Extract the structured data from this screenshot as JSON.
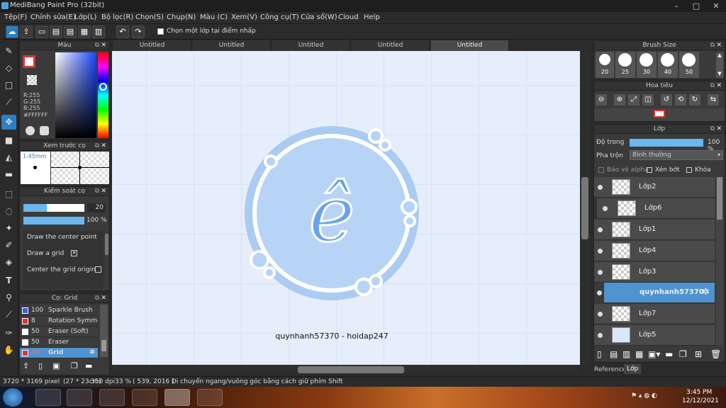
{
  "app": {
    "title": "MediBang Paint Pro (32bit)"
  },
  "menu": [
    "Tệp(F)",
    "Chỉnh sửa(E)",
    "Lớp(L)",
    "Bộ lọc(R)",
    "Chọn(S)",
    "Chụp(N)",
    "Màu (C)",
    "Xem(V)",
    "Công cụ(T)",
    "Cửa sổ(W)",
    "Cloud",
    "Help"
  ],
  "toolbar": {
    "select_one_layer_label": "Chọn một lớp tại điểm nhấp"
  },
  "tabs": [
    "Untitled",
    "Untitled",
    "Untitled",
    "Untitled",
    "Untitled"
  ],
  "color_panel": {
    "title": "Màu",
    "r": "R:255",
    "g": "G:255",
    "b": "B:255",
    "hex": "#FFFFFF"
  },
  "brush_preview": {
    "title": "Xem trước cọ",
    "size": "1.45mm"
  },
  "brush_control": {
    "title": "Kiểm soát cọ",
    "size_value": "20",
    "opacity_value": "100 %",
    "options": [
      "Draw the center point",
      "Draw a grid",
      "Center the grid origin"
    ]
  },
  "brush_list": {
    "title": "Cọ: Grid",
    "items": [
      {
        "size": "100",
        "name": "Sparkle Brush",
        "color": "#3b5bdb"
      },
      {
        "size": "8",
        "name": "Rotation Symmetry",
        "color": "#e03131"
      },
      {
        "size": "50",
        "name": "Eraser (Soft)",
        "color": "#ffffff"
      },
      {
        "size": "50",
        "name": "Eraser",
        "color": "#ffffff"
      },
      {
        "size": "20",
        "name": "Grid",
        "color": "#e03131"
      }
    ]
  },
  "brush_size": {
    "title": "Brush Size",
    "sizes": [
      "20",
      "25",
      "30",
      "40",
      "50"
    ]
  },
  "navigator": {
    "title": "Hoa tiêu"
  },
  "layers": {
    "title": "Lớp",
    "opacity_label": "Độ trong",
    "opacity_value": "100 %",
    "blend_label": "Pha trộn",
    "blend_value": "Bình thường",
    "protect_alpha": "Bảo vệ alpha",
    "clipping": "Xén bớt",
    "lock": "Khóa",
    "items": [
      "Lớp2",
      "Lớp6",
      "Lớp1",
      "Lớp4",
      "Lớp3",
      "quynhanh57370 -",
      "Lớp7",
      "Lớp5"
    ]
  },
  "bottom_tabs": [
    "Reference",
    "Lớp"
  ],
  "canvas": {
    "letter": "ê",
    "watermark": "quynhanh57370 - hoidap247"
  },
  "status": {
    "dims": "3720 * 3169 pixel",
    "cm": "(27 * 23cm)",
    "dpi": "350 dpi",
    "zoom": "33 %",
    "coords": "( 539, 2016 )",
    "hint": "Di chuyển ngang/vuông góc bằng cách giữ phím Shift"
  },
  "taskbar": {
    "time": "3:45 PM",
    "date": "12/12/2021"
  }
}
